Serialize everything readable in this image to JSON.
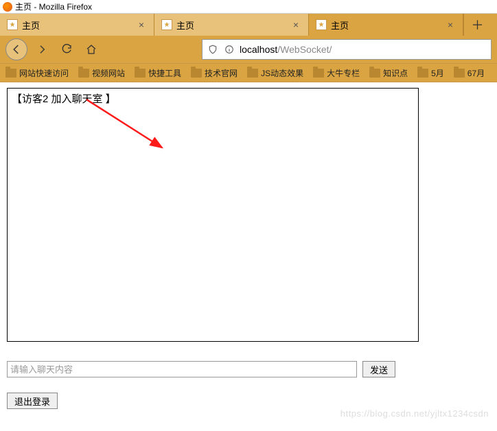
{
  "window": {
    "title": "主页 - Mozilla Firefox"
  },
  "tabs": [
    {
      "title": "主页",
      "active": false
    },
    {
      "title": "主页",
      "active": false
    },
    {
      "title": "主页",
      "active": true
    }
  ],
  "url": {
    "host": "localhost",
    "path": "/WebSocket/"
  },
  "bookmarks": [
    {
      "label": "网站快速访问"
    },
    {
      "label": "视频网站"
    },
    {
      "label": "快捷工具"
    },
    {
      "label": "技术官网"
    },
    {
      "label": "JS动态效果"
    },
    {
      "label": "大牛专栏"
    },
    {
      "label": "知识点"
    },
    {
      "label": "5月"
    },
    {
      "label": "67月"
    }
  ],
  "chat": {
    "messages": [
      "【访客2 加入聊天室 】"
    ],
    "input_placeholder": "请输入聊天内容",
    "send_label": "发送",
    "logout_label": "退出登录"
  },
  "watermark": "https://blog.csdn.net/yjltx1234csdn"
}
